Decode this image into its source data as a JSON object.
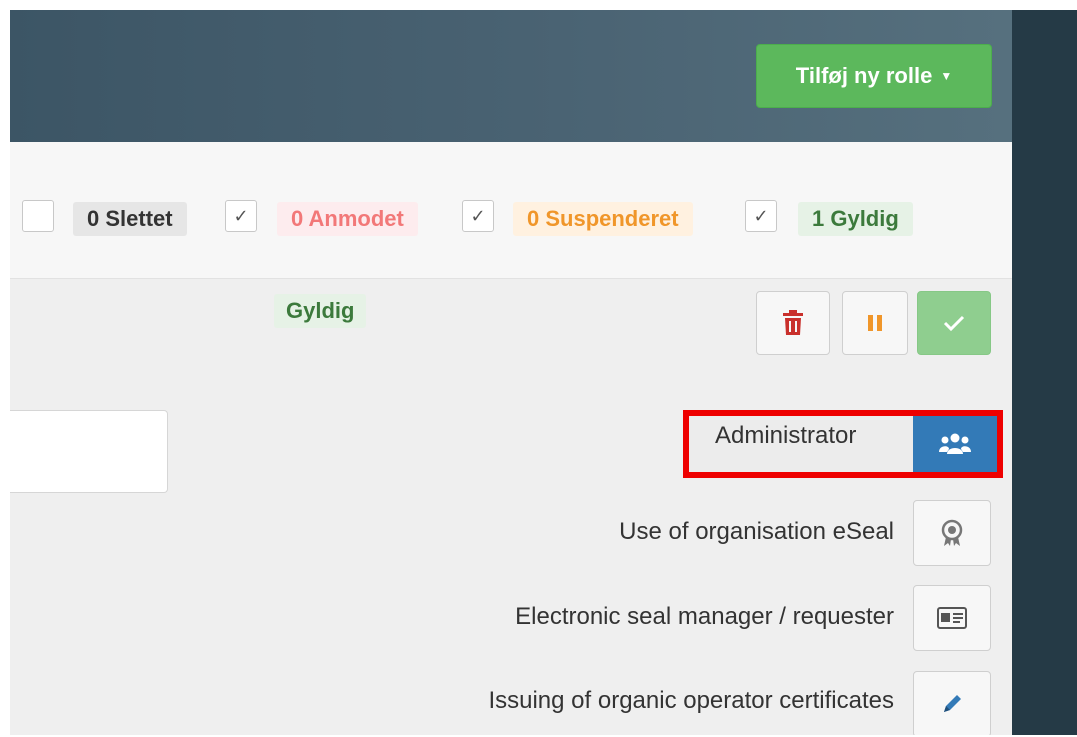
{
  "header": {
    "add_role_button": "Tilføj ny rolle"
  },
  "filters": [
    {
      "label": "0 Slettet",
      "checked": false
    },
    {
      "label": "0 Anmodet",
      "checked": true
    },
    {
      "label": "0 Suspenderet",
      "checked": true
    },
    {
      "label": "1 Gyldig",
      "checked": true
    }
  ],
  "checkmark": "✓",
  "row": {
    "status": "Gyldig",
    "actions": [
      "delete",
      "suspend",
      "validate"
    ]
  },
  "roles": [
    {
      "label": "Administrator",
      "icon": "users-icon",
      "active": true
    },
    {
      "label": "Use of organisation eSeal",
      "icon": "certificate-icon",
      "active": false
    },
    {
      "label": "Electronic seal manager / requester",
      "icon": "id-card-icon",
      "active": false
    },
    {
      "label": "Issuing of organic operator certificates",
      "icon": "pencil-icon",
      "active": false
    }
  ],
  "colors": {
    "success": "#5cb85c",
    "primary": "#337ab7",
    "danger": "#c9302c",
    "warning": "#f0962a",
    "highlight": "#ee0000"
  }
}
